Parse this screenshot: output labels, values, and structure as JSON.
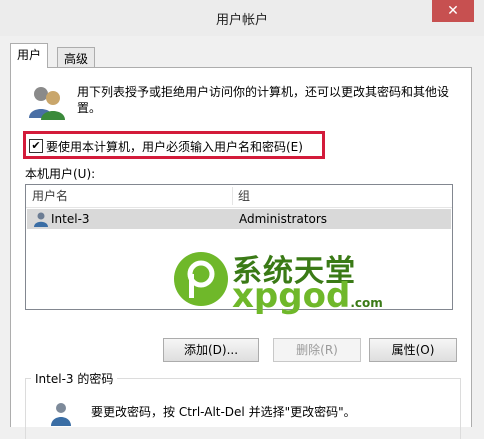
{
  "window": {
    "title": "用户帐户",
    "close_glyph": "✕",
    "tabs": [
      {
        "label": "用户"
      },
      {
        "label": "高级"
      }
    ]
  },
  "users_tab": {
    "description": "用下列表授予或拒绝用户访问你的计算机，还可以更改其密码和其他设置。",
    "require_login_checkbox": {
      "label": "要使用本计算机，用户必须输入用户名和密码(E)",
      "checked": true,
      "check_glyph": "✔"
    },
    "local_users_label": "本机用户(U):",
    "table": {
      "columns": [
        "用户名",
        "组"
      ],
      "rows": [
        {
          "username": "Intel-3",
          "group": "Administrators"
        }
      ]
    },
    "buttons": {
      "add": "添加(D)...",
      "remove": "删除(R)",
      "properties": "属性(O)"
    },
    "password_group": {
      "title": "Intel-3 的密码",
      "text": "要更改密码，按 Ctrl-Alt-Del 并选择\"更改密码\"。"
    }
  },
  "watermark": {
    "cn": "系统天堂",
    "en": "xpgod",
    "tld": ".com"
  },
  "colors": {
    "highlight_border": "#d31b3a",
    "close_button": "#c75050",
    "selected_row": "#d9d9d9",
    "watermark_green": "#6fb82a"
  },
  "icons": {
    "users": "users-icon",
    "user_row": "user-icon",
    "password": "password-user-icon",
    "watermark_logo": "xpgod-logo-icon"
  }
}
